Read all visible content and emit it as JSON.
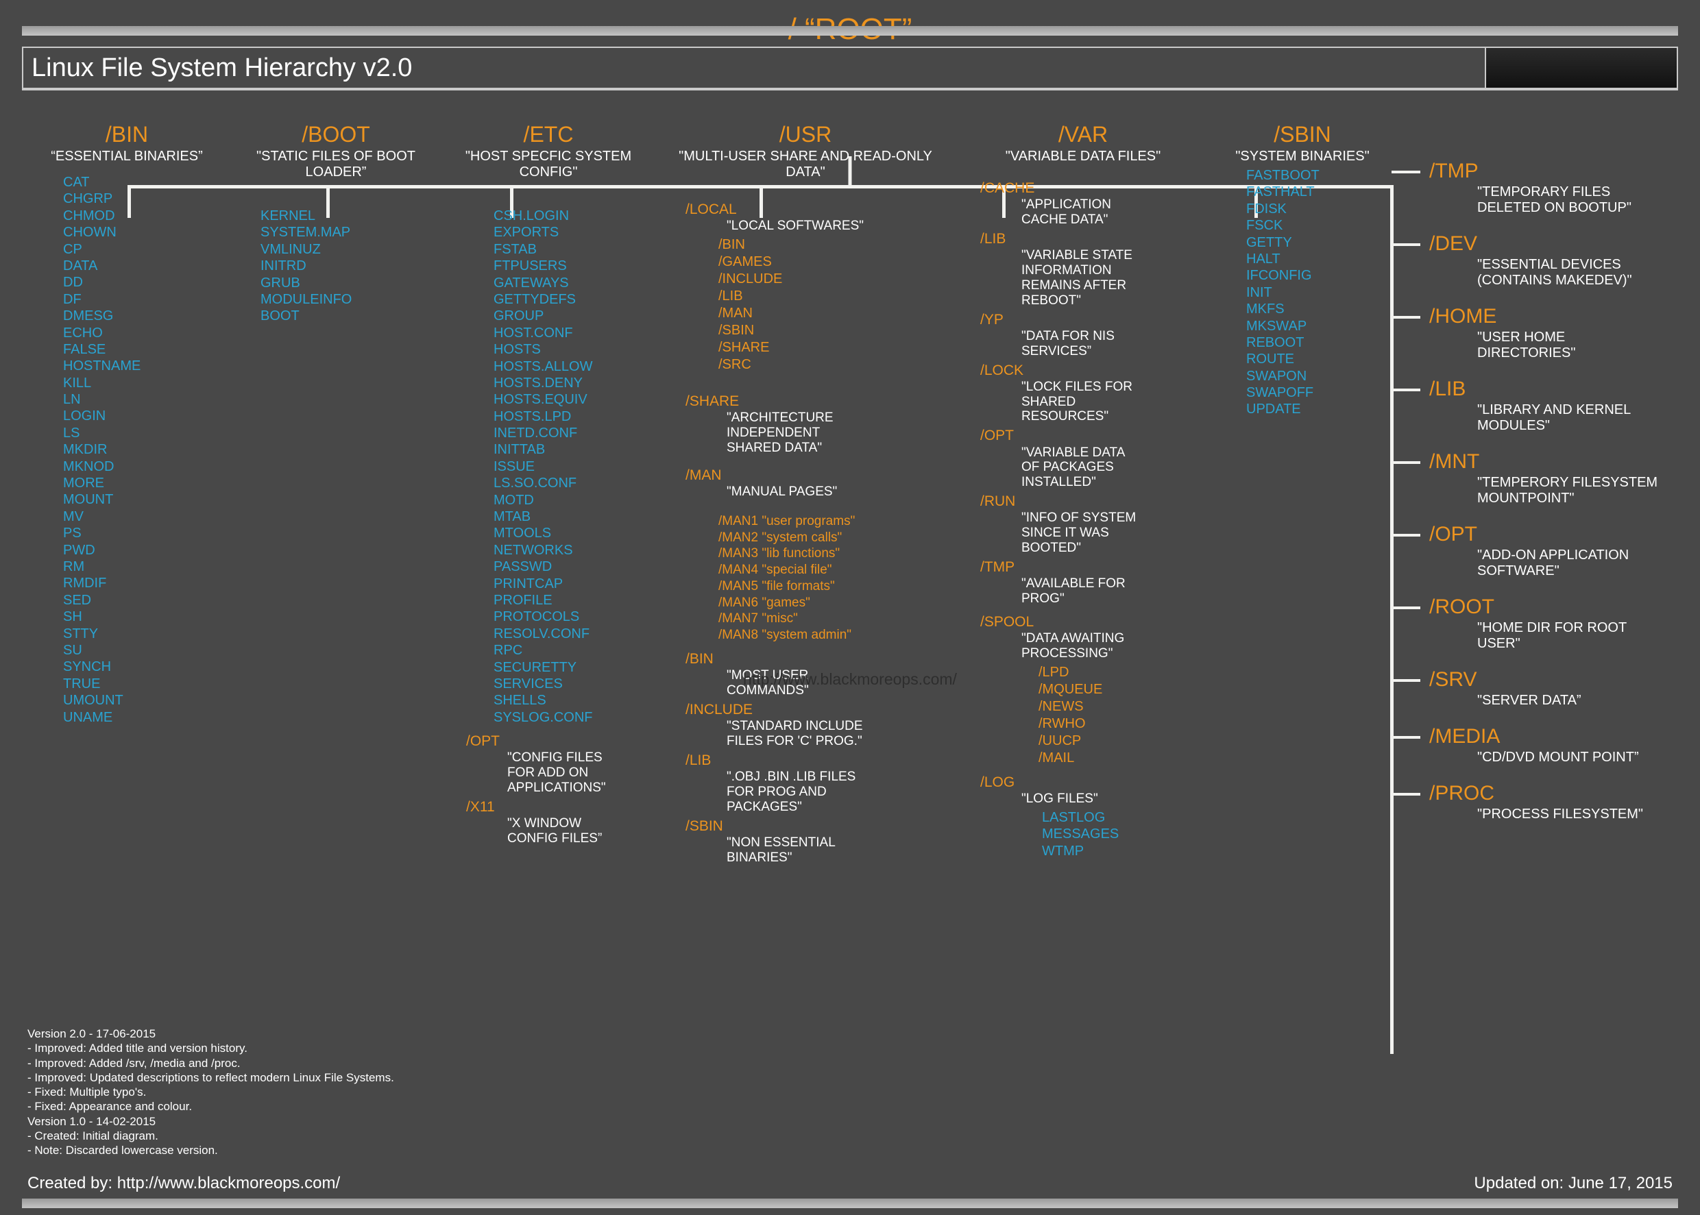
{
  "title": "Linux File System Hierarchy v2.0",
  "root": "/ “ROOT”",
  "watermark": "http://www.blackmoreops.com/",
  "columns": {
    "bin": {
      "title": "/BIN",
      "desc": "“ESSENTIAL BINARIES”",
      "files": [
        "CAT",
        "CHGRP",
        "CHMOD",
        "CHOWN",
        "CP",
        "DATA",
        "DD",
        "DF",
        "DMESG",
        "ECHO",
        "FALSE",
        "HOSTNAME",
        "KILL",
        "LN",
        "LOGIN",
        "LS",
        "MKDIR",
        "MKNOD",
        "MORE",
        "MOUNT",
        "MV",
        "PS",
        "PWD",
        "RM",
        "RMDIF",
        "SED",
        "SH",
        "STTY",
        "SU",
        "SYNCH",
        "TRUE",
        "UMOUNT",
        "UNAME"
      ]
    },
    "boot": {
      "title": "/BOOT",
      "desc": "\"STATIC FILES OF BOOT LOADER”",
      "files": [
        "KERNEL",
        "SYSTEM.MAP",
        "VMLINUZ",
        "INITRD",
        "GRUB",
        "MODULEINFO",
        "BOOT"
      ]
    },
    "etc": {
      "title": "/ETC",
      "desc": "\"HOST SPECFIC SYSTEM CONFIG\"",
      "files": [
        "CSH.LOGIN",
        "EXPORTS",
        "FSTAB",
        "FTPUSERS",
        "GATEWAYS",
        "GETTYDEFS",
        "GROUP",
        "HOST.CONF",
        "HOSTS",
        "HOSTS.ALLOW",
        "HOSTS.DENY",
        "HOSTS.EQUIV",
        "HOSTS.LPD",
        "INETD.CONF",
        "INITTAB",
        "ISSUE",
        "LS.SO.CONF",
        "MOTD",
        "MTAB",
        "MTOOLS",
        "NETWORKS",
        "PASSWD",
        "PRINTCAP",
        "PROFILE",
        "PROTOCOLS",
        "RESOLV.CONF",
        "RPC",
        "SECURETTY",
        "SERVICES",
        "SHELLS",
        "SYSLOG.CONF"
      ],
      "subs": [
        {
          "dir": "/OPT",
          "desc": "\"CONFIG FILES FOR ADD ON APPLICATIONS\""
        },
        {
          "dir": "/X11",
          "desc": "\"X WINDOW CONFIG FILES”"
        }
      ]
    },
    "usr": {
      "title": "/USR",
      "desc": "\"MULTI-USER SHARE AND READ-ONLY DATA\"",
      "local": {
        "dir": "/LOCAL",
        "desc": "\"LOCAL SOFTWARES\"",
        "dirs": [
          "/BIN",
          "/GAMES",
          "/INCLUDE",
          "/LIB",
          "/MAN",
          "/SBIN",
          "/SHARE",
          "/SRC"
        ]
      },
      "share": {
        "dir": "/SHARE",
        "desc": "\"ARCHITECTURE INDEPENDENT SHARED DATA\""
      },
      "man": {
        "dir": "/MAN",
        "desc": "\"MANUAL PAGES\"",
        "entries": [
          "/MAN1 \"user programs\"",
          "/MAN2 \"system calls\"",
          "/MAN3 \"lib functions\"",
          "/MAN4 \"special file\"",
          "/MAN5 \"file formats\"",
          "/MAN6 \"games\"",
          "/MAN7 \"misc\"",
          "/MAN8 \"system admin\""
        ]
      },
      "others": [
        {
          "dir": "/BIN",
          "desc": "\"MOST USER COMMANDS\""
        },
        {
          "dir": "/INCLUDE",
          "desc": "\"STANDARD INCLUDE FILES FOR 'C' PROG.\""
        },
        {
          "dir": "/LIB",
          "desc": "\".OBJ .BIN .LIB FILES FOR PROG AND PACKAGES\""
        },
        {
          "dir": "/SBIN",
          "desc": "\"NON ESSENTIAL BINARIES\""
        }
      ]
    },
    "var": {
      "title": "/VAR",
      "desc": "\"VARIABLE DATA FILES\"",
      "subs": [
        {
          "dir": "/CACHE",
          "desc": "\"APPLICATION CACHE DATA\""
        },
        {
          "dir": "/LIB",
          "desc": "\"VARIABLE STATE INFORMATION REMAINS AFTER REBOOT\""
        },
        {
          "dir": "/YP",
          "desc": "\"DATA FOR NIS SERVICES”"
        },
        {
          "dir": "/LOCK",
          "desc": "\"LOCK FILES FOR SHARED RESOURCES\""
        },
        {
          "dir": "/OPT",
          "desc": "\"VARIABLE DATA OF PACKAGES INSTALLED\""
        },
        {
          "dir": "/RUN",
          "desc": "\"INFO OF SYSTEM SINCE IT WAS BOOTED\""
        },
        {
          "dir": "/TMP",
          "desc": "\"AVAILABLE FOR PROG\""
        }
      ],
      "spool": {
        "dir": "/SPOOL",
        "desc": "\"DATA AWAITING PROCESSING\"",
        "dirs": [
          "/LPD",
          "/MQUEUE",
          "/NEWS",
          "/RWHO",
          "/UUCP",
          "/MAIL"
        ]
      },
      "log": {
        "dir": "/LOG",
        "desc": "\"LOG FILES\"",
        "files": [
          "LASTLOG",
          "MESSAGES",
          "WTMP"
        ]
      }
    },
    "sbin": {
      "title": "/SBIN",
      "desc": "\"SYSTEM BINARIES\"",
      "files": [
        "FASTBOOT",
        "FASTHALT",
        "FDISK",
        "FSCK",
        "GETTY",
        "HALT",
        "IFCONFIG",
        "INIT",
        "MKFS",
        "MKSWAP",
        "REBOOT",
        "ROUTE",
        "SWAPON",
        "SWAPOFF",
        "UPDATE"
      ]
    }
  },
  "right": [
    {
      "h": "/TMP",
      "d": "\"TEMPORARY FILES DELETED ON BOOTUP\""
    },
    {
      "h": "/DEV",
      "d": "\"ESSENTIAL DEVICES (CONTAINS MAKEDEV)\""
    },
    {
      "h": "/HOME",
      "d": "\"USER HOME DIRECTORIES\""
    },
    {
      "h": "/LIB",
      "d": "\"LIBRARY AND KERNEL MODULES\""
    },
    {
      "h": "/MNT",
      "d": "\"TEMPERORY FILESYSTEM MOUNTPOINT\""
    },
    {
      "h": "/OPT",
      "d": "\"ADD-ON APPLICATION SOFTWARE\""
    },
    {
      "h": "/ROOT",
      "d": "\"HOME DIR FOR ROOT USER\""
    },
    {
      "h": "/SRV",
      "d": "\"SERVER DATA”"
    },
    {
      "h": "/MEDIA",
      "d": "\"CD/DVD MOUNT POINT”"
    },
    {
      "h": "/PROC",
      "d": "\"PROCESS FILESYSTEM\""
    }
  ],
  "version": [
    "Version 2.0 - 17-06-2015",
    "- Improved: Added title and version history.",
    "- Improved: Added /srv, /media and /proc.",
    "- Improved: Updated descriptions to reflect modern Linux File Systems.",
    "- Fixed: Multiple typo's.",
    "- Fixed: Appearance and colour.",
    "Version 1.0 - 14-02-2015",
    "- Created: Initial diagram.",
    "- Note: Discarded lowercase version."
  ],
  "footer": {
    "left": "Created by: http://www.blackmoreops.com/",
    "right": "Updated on: June 17, 2015"
  }
}
